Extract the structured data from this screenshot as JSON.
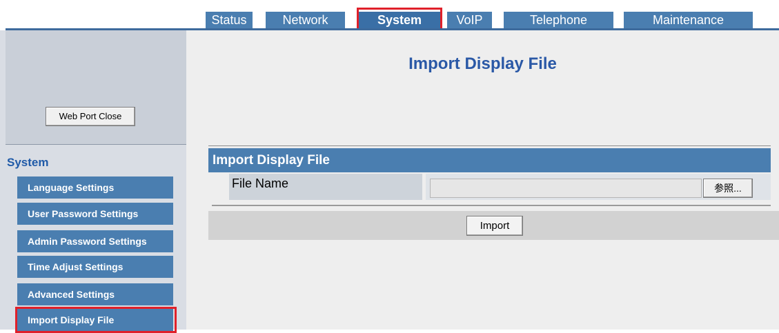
{
  "tabs": [
    "Status",
    "Network",
    "System",
    "VoIP",
    "Telephone",
    "Maintenance"
  ],
  "active_tab": "System",
  "sidebar": {
    "web_port_button": "Web Port Close",
    "section_title": "System",
    "items": [
      "Language Settings",
      "User Password Settings",
      "Admin Password Settings",
      "Time Adjust Settings",
      "Advanced Settings",
      "Import Display File"
    ]
  },
  "main": {
    "page_title": "Import Display File",
    "panel_title": "Import Display File",
    "file_name_label": "File Name",
    "file_input_value": "",
    "browse_label": "参照...",
    "import_button": "Import"
  },
  "colors": {
    "tab_bg": "#4a7eb0",
    "highlight": "#e0202a",
    "title": "#2a58a6"
  }
}
